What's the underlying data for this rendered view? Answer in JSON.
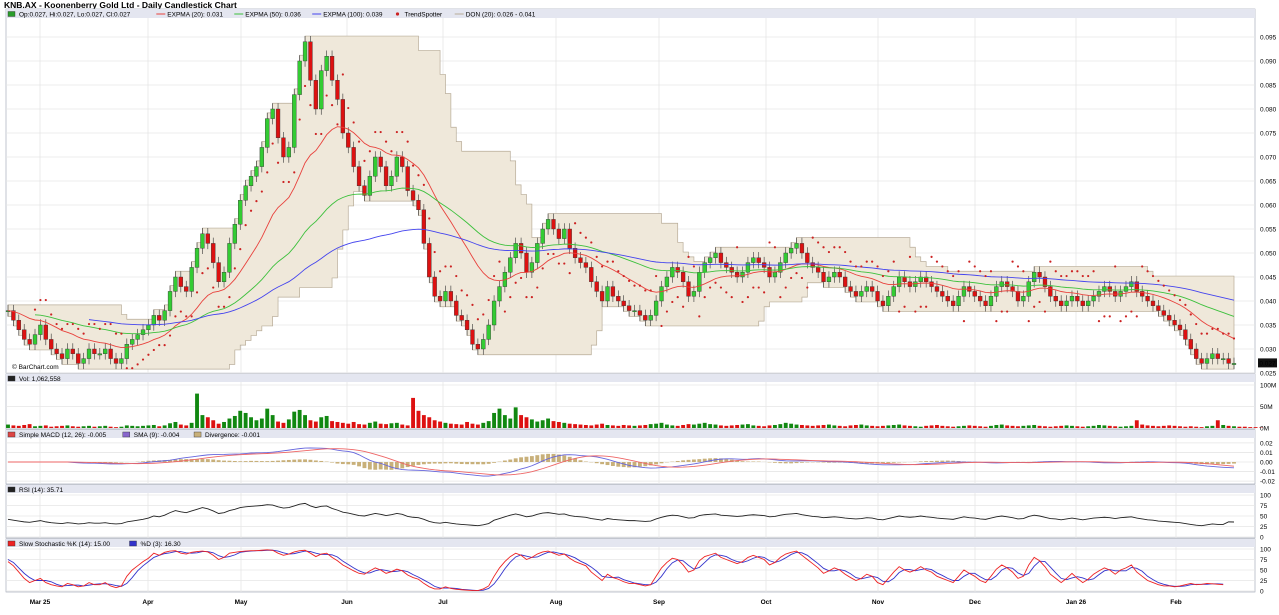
{
  "title": "KNB.AX - Koonenberry Gold Ltd - Daily Candlestick Chart",
  "watermark": "© BarChart.com",
  "colors": {
    "up": "#33cc33",
    "down": "#dd1111",
    "ema20": "#e8413c",
    "ema50": "#3cc03c",
    "ema100": "#4444ee",
    "trendspotter": "#cc2222",
    "donchian_fill": "#efe8da",
    "donchian_line": "#b8ac98",
    "macd": "#6666dd",
    "macd_signal": "#ee6666",
    "macd_hist": "#c8b07a",
    "rsi": "#222222",
    "stoch_k": "#ee2222",
    "stoch_d": "#3333cc",
    "grid": "#e6e6e6",
    "panel_header": "#e4e6f0"
  },
  "legends": {
    "price": [
      {
        "swatch": "box",
        "color": "#2a9d2a",
        "text": "Op:0.027, Hi:0.027, Lo:0.027, Cl:0.027"
      },
      {
        "swatch": "line",
        "color": "#e8413c",
        "text": "EXPMA (20): 0.031"
      },
      {
        "swatch": "line",
        "color": "#3cc03c",
        "text": "EXPMA (50): 0.036"
      },
      {
        "swatch": "line",
        "color": "#4444ee",
        "text": "EXPMA (100): 0.039"
      },
      {
        "swatch": "dot",
        "color": "#cc2222",
        "text": "TrendSpotter"
      },
      {
        "swatch": "line",
        "color": "#b8ac98",
        "text": "DON (20): 0.026 - 0.041"
      }
    ],
    "volume": [
      {
        "swatch": "box",
        "color": "#222222",
        "text": "Vol: 1,062,558"
      }
    ],
    "macd": [
      {
        "swatch": "box",
        "color": "#dd4444",
        "text": "Simple MACD (12, 26): -0.005"
      },
      {
        "swatch": "box",
        "color": "#8866cc",
        "text": "SMA (9): -0.004"
      },
      {
        "swatch": "box",
        "color": "#c8b07a",
        "text": "Divergence: -0.001"
      }
    ],
    "rsi": [
      {
        "swatch": "box",
        "color": "#222222",
        "text": "RSI (14): 35.71"
      }
    ],
    "stoch": [
      {
        "swatch": "box",
        "color": "#ee2222",
        "text": "Slow Stochastic %K (14): 15.00"
      },
      {
        "swatch": "box",
        "color": "#3333cc",
        "text": "%D (3): 16.30"
      }
    ]
  },
  "axes": {
    "price_ticks": [
      "0.095",
      "0.090",
      "0.085",
      "0.080",
      "0.075",
      "0.070",
      "0.065",
      "0.060",
      "0.055",
      "0.050",
      "0.045",
      "0.040",
      "0.035",
      "0.030",
      "0.025"
    ],
    "volume_ticks": [
      "100M",
      "50M",
      "0M"
    ],
    "macd_ticks": [
      "0.02",
      "0.01",
      "0.00",
      "-0.01",
      "-0.02"
    ],
    "rsi_ticks": [
      "100",
      "75",
      "50",
      "25",
      "0"
    ],
    "stoch_ticks": [
      "100",
      "75",
      "50",
      "25",
      "0"
    ],
    "months": [
      "Mar 25",
      "Apr",
      "May",
      "Jun",
      "Jul",
      "Aug",
      "Sep",
      "Oct",
      "Nov",
      "Dec",
      "Jan 26",
      "Feb"
    ],
    "last_price_tag": "0.027"
  },
  "chart_data": {
    "type": "candlestick",
    "title": "KNB.AX - Koonenberry Gold Ltd - Daily Candlestick Chart",
    "ylim": [
      0.025,
      0.097
    ],
    "months": [
      "Mar 25",
      "Apr",
      "May",
      "Jun",
      "Jul",
      "Aug",
      "Sep",
      "Oct",
      "Nov",
      "Dec",
      "Jan 26",
      "Feb"
    ],
    "close": [
      0.038,
      0.036,
      0.034,
      0.032,
      0.031,
      0.033,
      0.035,
      0.032,
      0.03,
      0.029,
      0.028,
      0.03,
      0.029,
      0.027,
      0.028,
      0.03,
      0.029,
      0.029,
      0.03,
      0.028,
      0.027,
      0.028,
      0.031,
      0.032,
      0.033,
      0.034,
      0.035,
      0.037,
      0.036,
      0.038,
      0.042,
      0.045,
      0.043,
      0.042,
      0.047,
      0.051,
      0.054,
      0.052,
      0.048,
      0.044,
      0.046,
      0.052,
      0.056,
      0.061,
      0.064,
      0.066,
      0.068,
      0.072,
      0.078,
      0.08,
      0.074,
      0.07,
      0.072,
      0.083,
      0.09,
      0.094,
      0.086,
      0.08,
      0.088,
      0.091,
      0.086,
      0.082,
      0.075,
      0.072,
      0.068,
      0.064,
      0.062,
      0.066,
      0.07,
      0.068,
      0.064,
      0.066,
      0.07,
      0.068,
      0.063,
      0.061,
      0.059,
      0.052,
      0.045,
      0.041,
      0.04,
      0.042,
      0.04,
      0.037,
      0.036,
      0.034,
      0.031,
      0.03,
      0.032,
      0.035,
      0.04,
      0.043,
      0.046,
      0.049,
      0.052,
      0.05,
      0.046,
      0.048,
      0.052,
      0.055,
      0.057,
      0.055,
      0.053,
      0.055,
      0.051,
      0.049,
      0.048,
      0.047,
      0.044,
      0.042,
      0.04,
      0.043,
      0.041,
      0.04,
      0.039,
      0.038,
      0.038,
      0.037,
      0.036,
      0.037,
      0.04,
      0.043,
      0.045,
      0.047,
      0.046,
      0.044,
      0.041,
      0.042,
      0.046,
      0.048,
      0.049,
      0.05,
      0.048,
      0.047,
      0.046,
      0.045,
      0.046,
      0.048,
      0.049,
      0.048,
      0.047,
      0.045,
      0.046,
      0.048,
      0.05,
      0.051,
      0.052,
      0.05,
      0.048,
      0.047,
      0.046,
      0.044,
      0.045,
      0.046,
      0.045,
      0.043,
      0.042,
      0.041,
      0.042,
      0.043,
      0.042,
      0.04,
      0.039,
      0.041,
      0.043,
      0.045,
      0.044,
      0.043,
      0.044,
      0.045,
      0.044,
      0.043,
      0.042,
      0.041,
      0.04,
      0.039,
      0.041,
      0.043,
      0.042,
      0.041,
      0.04,
      0.039,
      0.041,
      0.043,
      0.044,
      0.043,
      0.042,
      0.04,
      0.041,
      0.044,
      0.046,
      0.045,
      0.043,
      0.041,
      0.04,
      0.039,
      0.04,
      0.041,
      0.04,
      0.039,
      0.04,
      0.041,
      0.042,
      0.043,
      0.042,
      0.041,
      0.042,
      0.043,
      0.044,
      0.042,
      0.041,
      0.04,
      0.039,
      0.038,
      0.037,
      0.036,
      0.035,
      0.034,
      0.032,
      0.03,
      0.028,
      0.027,
      0.028,
      0.029,
      0.028,
      0.028,
      0.027,
      0.027
    ],
    "volume_m": [
      8,
      6,
      5,
      7,
      9,
      4,
      5,
      6,
      3,
      4,
      5,
      6,
      4,
      3,
      4,
      5,
      3,
      4,
      5,
      3,
      2,
      3,
      6,
      5,
      4,
      5,
      6,
      7,
      4,
      6,
      11,
      14,
      8,
      6,
      12,
      80,
      30,
      25,
      18,
      10,
      14,
      22,
      28,
      40,
      35,
      25,
      18,
      22,
      45,
      30,
      15,
      12,
      20,
      38,
      42,
      30,
      18,
      15,
      25,
      28,
      16,
      14,
      12,
      10,
      14,
      9,
      8,
      12,
      15,
      10,
      9,
      11,
      12,
      8,
      6,
      70,
      40,
      30,
      25,
      18,
      15,
      12,
      10,
      9,
      8,
      14,
      10,
      8,
      12,
      16,
      35,
      45,
      30,
      22,
      48,
      30,
      25,
      20,
      15,
      18,
      22,
      16,
      14,
      12,
      10,
      9,
      8,
      7,
      6,
      8,
      10,
      7,
      6,
      5,
      7,
      6,
      5,
      6,
      7,
      9,
      10,
      12,
      8,
      6,
      5,
      7,
      9,
      8,
      10,
      12,
      9,
      8,
      6,
      5,
      6,
      7,
      8,
      9,
      6,
      5,
      4,
      6,
      7,
      9,
      12,
      10,
      8,
      7,
      6,
      5,
      6,
      7,
      8,
      6,
      5,
      4,
      6,
      7,
      8,
      6,
      5,
      4,
      5,
      6,
      7,
      8,
      6,
      5,
      4,
      3,
      5,
      6,
      7,
      5,
      4,
      3,
      4,
      5,
      6,
      5,
      4,
      3,
      5,
      7,
      8,
      6,
      5,
      4,
      5,
      6,
      7,
      5,
      4,
      3,
      4,
      5,
      6,
      5,
      4,
      3,
      4,
      5,
      7,
      6,
      5,
      4,
      3,
      4,
      5,
      18,
      8,
      6,
      5,
      4,
      5,
      6,
      5,
      4,
      3,
      4,
      3,
      2,
      4,
      5,
      18,
      7,
      5,
      4,
      3,
      3,
      2,
      2,
      1
    ],
    "rsi": [
      42,
      40,
      38,
      36,
      35,
      37,
      39,
      36,
      34,
      33,
      32,
      34,
      33,
      31,
      32,
      34,
      33,
      33,
      34,
      32,
      31,
      32,
      36,
      38,
      40,
      42,
      45,
      50,
      48,
      52,
      58,
      63,
      60,
      58,
      62,
      66,
      70,
      67,
      62,
      56,
      58,
      63,
      66,
      70,
      72,
      73,
      74,
      75,
      77,
      76,
      72,
      69,
      70,
      74,
      78,
      80,
      74,
      70,
      73,
      74,
      68,
      64,
      59,
      57,
      54,
      51,
      50,
      53,
      56,
      54,
      51,
      53,
      56,
      54,
      49,
      47,
      46,
      42,
      37,
      34,
      33,
      35,
      33,
      31,
      30,
      29,
      28,
      27,
      29,
      32,
      40,
      44,
      48,
      52,
      55,
      52,
      48,
      50,
      54,
      57,
      58,
      56,
      54,
      55,
      51,
      49,
      48,
      47,
      44,
      42,
      40,
      44,
      42,
      41,
      40,
      39,
      39,
      38,
      37,
      38,
      43,
      47,
      50,
      52,
      51,
      48,
      45,
      46,
      51,
      53,
      54,
      55,
      52,
      51,
      50,
      49,
      50,
      52,
      53,
      52,
      51,
      48,
      49,
      52,
      54,
      55,
      56,
      53,
      51,
      49,
      48,
      46,
      47,
      48,
      47,
      45,
      44,
      43,
      44,
      46,
      45,
      42,
      41,
      44,
      47,
      50,
      48,
      47,
      48,
      50,
      48,
      47,
      45,
      44,
      43,
      42,
      45,
      48,
      46,
      45,
      43,
      42,
      45,
      48,
      50,
      48,
      46,
      43,
      44,
      49,
      52,
      50,
      47,
      44,
      43,
      41,
      43,
      45,
      43,
      41,
      43,
      45,
      46,
      47,
      46,
      44,
      46,
      47,
      48,
      45,
      43,
      41,
      40,
      38,
      37,
      36,
      35,
      34,
      32,
      30,
      28,
      27,
      29,
      31,
      30,
      30,
      36,
      35.71
    ],
    "stoch_k": [
      70,
      60,
      45,
      30,
      20,
      25,
      30,
      20,
      15,
      12,
      10,
      18,
      15,
      10,
      12,
      20,
      15,
      15,
      20,
      12,
      8,
      12,
      35,
      50,
      60,
      70,
      78,
      90,
      85,
      92,
      95,
      96,
      90,
      88,
      92,
      94,
      95,
      93,
      85,
      75,
      80,
      90,
      92,
      94,
      95,
      96,
      96,
      97,
      98,
      97,
      90,
      85,
      88,
      93,
      96,
      97,
      90,
      82,
      88,
      90,
      80,
      72,
      62,
      55,
      48,
      42,
      40,
      48,
      55,
      50,
      42,
      46,
      52,
      48,
      38,
      32,
      28,
      18,
      10,
      5,
      5,
      10,
      6,
      4,
      3,
      2,
      1,
      1,
      5,
      12,
      35,
      55,
      70,
      82,
      90,
      85,
      75,
      80,
      88,
      93,
      95,
      90,
      85,
      88,
      78,
      70,
      65,
      60,
      45,
      35,
      25,
      40,
      32,
      28,
      22,
      18,
      18,
      15,
      12,
      15,
      35,
      55,
      68,
      78,
      75,
      62,
      45,
      50,
      72,
      82,
      86,
      90,
      80,
      75,
      70,
      65,
      70,
      80,
      85,
      80,
      75,
      62,
      68,
      80,
      88,
      92,
      95,
      85,
      75,
      65,
      55,
      42,
      48,
      55,
      50,
      40,
      32,
      25,
      30,
      40,
      35,
      20,
      15,
      30,
      45,
      58,
      50,
      45,
      50,
      58,
      50,
      45,
      35,
      30,
      25,
      20,
      35,
      50,
      42,
      35,
      25,
      20,
      35,
      52,
      62,
      55,
      45,
      30,
      35,
      62,
      80,
      72,
      58,
      40,
      30,
      20,
      30,
      42,
      30,
      20,
      28,
      40,
      48,
      55,
      50,
      40,
      50,
      55,
      62,
      45,
      35,
      25,
      20,
      15,
      12,
      12,
      10,
      12,
      15,
      18,
      15,
      16,
      18,
      17,
      16,
      15
    ],
    "stoch_d": [
      75,
      68,
      55,
      42,
      32,
      25,
      25,
      25,
      22,
      16,
      12,
      13,
      14,
      14,
      12,
      14,
      16,
      17,
      17,
      16,
      13,
      11,
      18,
      32,
      48,
      60,
      70,
      80,
      85,
      89,
      91,
      94,
      94,
      91,
      90,
      91,
      94,
      94,
      91,
      84,
      80,
      82,
      86,
      92,
      94,
      95,
      96,
      96,
      97,
      97,
      95,
      91,
      88,
      89,
      92,
      95,
      94,
      90,
      87,
      87,
      86,
      81,
      71,
      63,
      55,
      48,
      43,
      43,
      48,
      51,
      49,
      46,
      47,
      49,
      46,
      39,
      33,
      26,
      19,
      11,
      7,
      7,
      7,
      6,
      4,
      3,
      2,
      1,
      2,
      6,
      17,
      34,
      53,
      69,
      81,
      86,
      83,
      80,
      81,
      87,
      92,
      93,
      90,
      88,
      84,
      79,
      71,
      65,
      57,
      47,
      35,
      33,
      32,
      33,
      27,
      23,
      19,
      17,
      15,
      15,
      21,
      35,
      53,
      67,
      74,
      72,
      61,
      52,
      56,
      68,
      80,
      86,
      85,
      82,
      75,
      70,
      68,
      72,
      78,
      82,
      80,
      72,
      68,
      72,
      79,
      87,
      92,
      91,
      85,
      75,
      65,
      54,
      48,
      48,
      51,
      48,
      41,
      32,
      29,
      32,
      35,
      32,
      23,
      22,
      30,
      44,
      51,
      51,
      48,
      51,
      53,
      51,
      43,
      37,
      30,
      25,
      25,
      35,
      42,
      42,
      34,
      27,
      27,
      36,
      50,
      56,
      54,
      43,
      37,
      42,
      59,
      71,
      70,
      57,
      43,
      30,
      27,
      31,
      34,
      31,
      26,
      29,
      39,
      48,
      51,
      48,
      48,
      48,
      56,
      54,
      47,
      35,
      27,
      20,
      16,
      13,
      11,
      11,
      12,
      15,
      16,
      16,
      16,
      17,
      17,
      16.3
    ],
    "last_close": 0.027
  }
}
